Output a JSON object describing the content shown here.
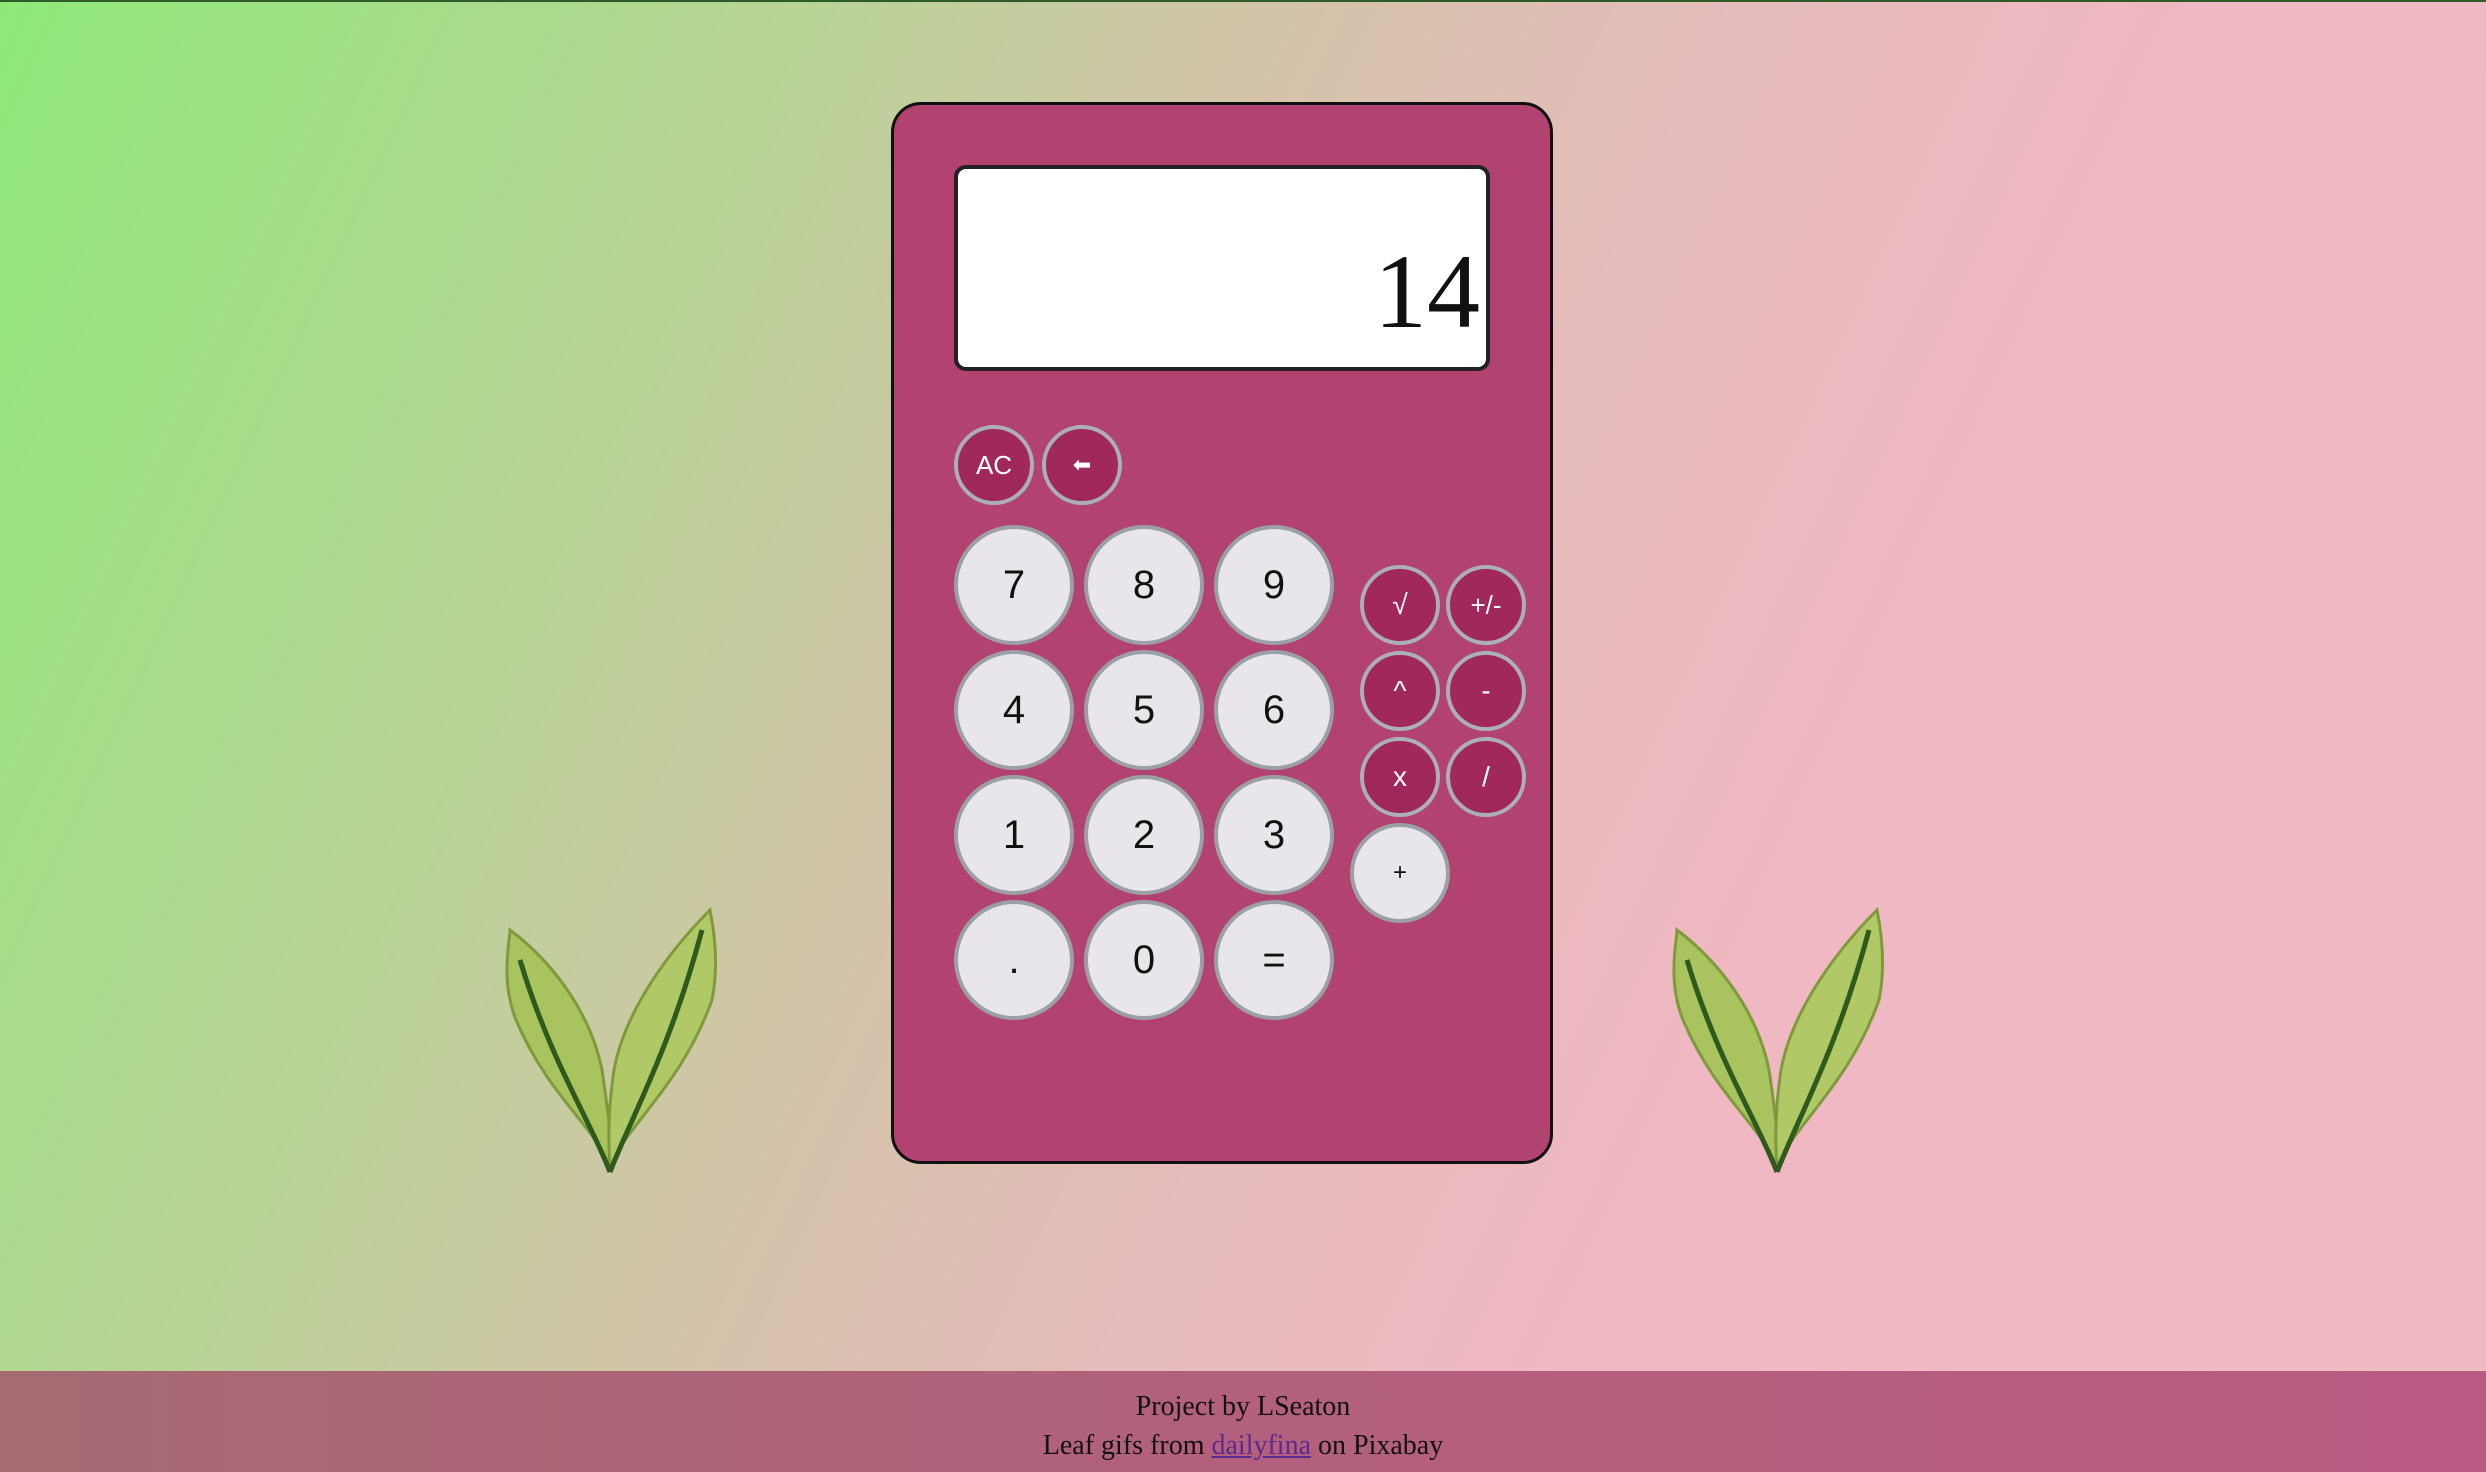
{
  "display": {
    "value": "14"
  },
  "buttons": {
    "clear": "AC",
    "backspace": "⬅",
    "digits": [
      "7",
      "8",
      "9",
      "4",
      "5",
      "6",
      "1",
      "2",
      "3",
      ".",
      "0",
      "="
    ],
    "sqrt": "√",
    "negate": "+/-",
    "power": "^",
    "minus": "-",
    "multiply": "x",
    "divide": "/",
    "plus": "+"
  },
  "footer": {
    "line1": "Project by LSeaton",
    "line2_prefix": "Leaf gifs from",
    "link_text": "dailyfina",
    "line2_suffix": "on Pixabay"
  },
  "colors": {
    "calculator_body": "#b2426f",
    "operator_button": "#a0285a",
    "number_button": "#e8e6ea",
    "leaf": "#a8c060"
  },
  "icons": [
    "leaf-icon",
    "backspace-arrow-icon"
  ]
}
